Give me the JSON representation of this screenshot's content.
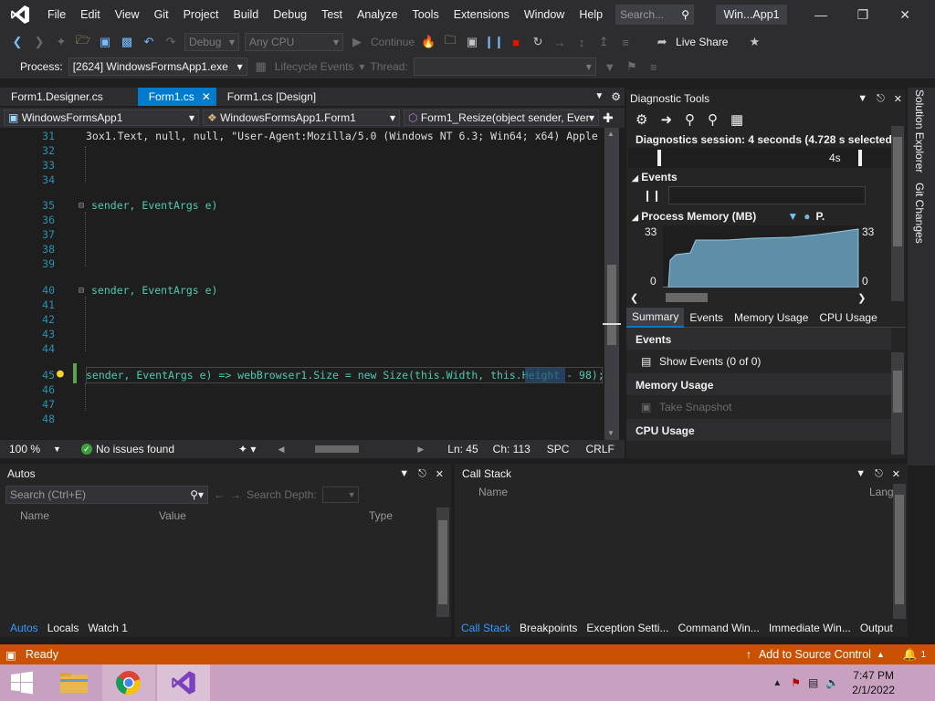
{
  "menubar": {
    "items": [
      "File",
      "Edit",
      "View",
      "Git",
      "Project",
      "Build",
      "Debug",
      "Test",
      "Analyze",
      "Tools",
      "Extensions",
      "Window",
      "Help"
    ],
    "search_placeholder": "Search...",
    "window_title": "Win...App1"
  },
  "toolbar": {
    "config": "Debug",
    "platform": "Any CPU",
    "continue_label": "Continue",
    "live_share": "Live Share",
    "process_label": "Process:",
    "process_value": "[2624] WindowsFormsApp1.exe",
    "lifecycle_label": "Lifecycle Events",
    "thread_label": "Thread:"
  },
  "tabs": [
    {
      "label": "Form1.Designer.cs"
    },
    {
      "label": "Form1.cs"
    },
    {
      "label": "Form1.cs [Design]"
    }
  ],
  "navbar": {
    "project": "WindowsFormsApp1",
    "class": "WindowsFormsApp1.Form1",
    "member": "Form1_Resize(object sender, Event"
  },
  "code": {
    "line_numbers": [
      "31",
      "32",
      "33",
      "34",
      "35",
      "36",
      "37",
      "38",
      "39",
      "40",
      "41",
      "42",
      "43",
      "44",
      "45",
      "46",
      "47",
      "48"
    ],
    "line31": "3ox1.Text, null, null, \"User-Agent:Mozilla/5.0 (Windows NT 6.3; Win64; x64) Apple",
    "line35": "sender, EventArgs e)",
    "line40": "sender, EventArgs e)",
    "line45": "sender, EventArgs e) => webBrowser1.Size = new Size(this.Width, this.Height - 98);"
  },
  "editor_status": {
    "zoom": "100 %",
    "issues": "No issues found",
    "ln": "Ln: 45",
    "ch": "Ch: 113",
    "spc": "SPC",
    "crlf": "CRLF"
  },
  "diagnostics": {
    "title": "Diagnostic Tools",
    "session": "Diagnostics session: 4 seconds (4.728 s selected)",
    "timeline_label": "4s",
    "events_header": "Events",
    "memory_header": "Process Memory (MB)",
    "legend_p": "P.",
    "ymax_left": "33",
    "ymin_left": "0",
    "ymax_right": "33",
    "ymin_right": "0",
    "tabs": [
      "Summary",
      "Events",
      "Memory Usage",
      "CPU Usage"
    ],
    "section_events": "Events",
    "show_events": "Show Events (0 of 0)",
    "section_memory": "Memory Usage",
    "take_snapshot": "Take Snapshot",
    "section_cpu": "CPU Usage"
  },
  "side_rail": {
    "solution_explorer": "Solution Explorer",
    "git_changes": "Git Changes"
  },
  "autos": {
    "title": "Autos",
    "search_placeholder": "Search (Ctrl+E)",
    "search_depth": "Search Depth:",
    "col_name": "Name",
    "col_value": "Value",
    "col_type": "Type",
    "tabs": [
      "Autos",
      "Locals",
      "Watch 1"
    ]
  },
  "callstack": {
    "title": "Call Stack",
    "col_name": "Name",
    "col_lang": "Lang",
    "tabs": [
      "Call Stack",
      "Breakpoints",
      "Exception Setti...",
      "Command Win...",
      "Immediate Win...",
      "Output"
    ]
  },
  "statusbar": {
    "ready": "Ready",
    "source_control": "Add to Source Control",
    "notif_count": "1"
  },
  "taskbar": {
    "time": "7:47 PM",
    "date": "2/1/2022"
  },
  "colors": {
    "accent": "#007acc",
    "status": "#ca5100",
    "taskbar": "#c8a0c0",
    "chart_fill": "#5f8fa8"
  }
}
